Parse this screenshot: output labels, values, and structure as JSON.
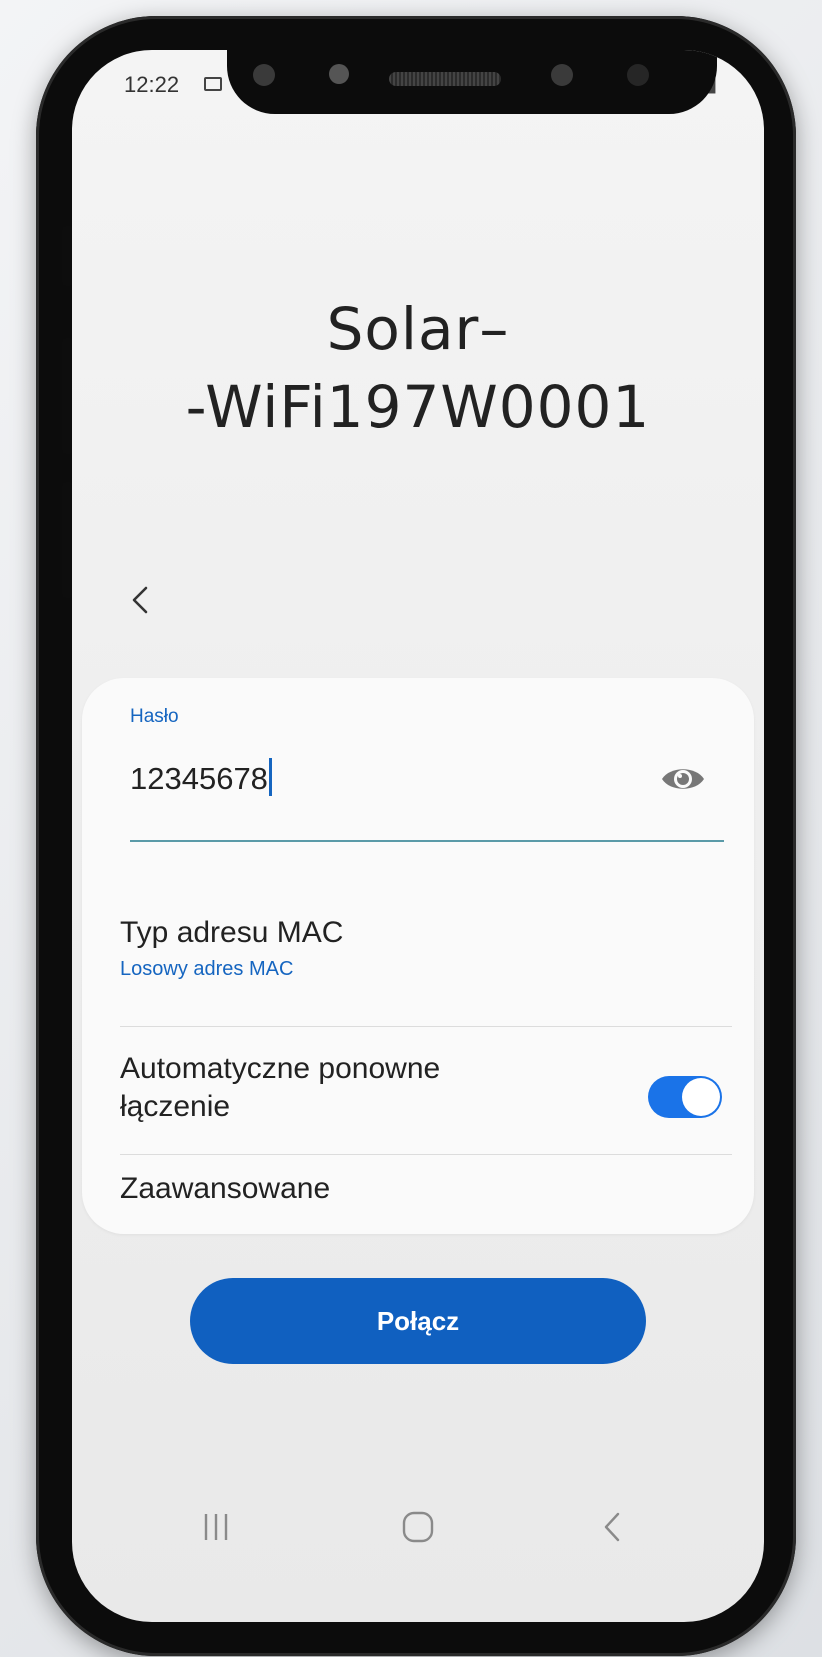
{
  "status_bar": {
    "time": "12:22",
    "right_icons": [
      "mute-icon",
      "airplane-icon",
      "battery-icon"
    ]
  },
  "network": {
    "title_line1": "Solar–",
    "title_line2": "-WiFi197W0001"
  },
  "password": {
    "label": "Hasło",
    "value": "12345678"
  },
  "mac": {
    "title": "Typ adresu MAC",
    "value": "Losowy adres MAC"
  },
  "auto_reconnect": {
    "title_line1": "Automatyczne ponowne",
    "title_line2": "łączenie",
    "enabled": true
  },
  "advanced": {
    "title": "Zaawansowane"
  },
  "connect_button": {
    "label": "Połącz"
  },
  "colors": {
    "accent": "#1565c0",
    "button": "#1060c0",
    "toggle_on": "#1a73e8"
  },
  "navigation": [
    "recent-apps-icon",
    "home-icon",
    "back-icon"
  ]
}
